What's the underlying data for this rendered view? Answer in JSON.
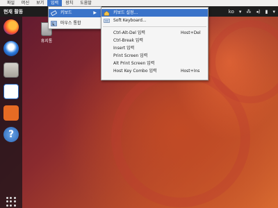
{
  "vm_menubar": {
    "items": [
      "파일",
      "머신",
      "보기",
      "입력",
      "장치",
      "도움말"
    ],
    "active_index": 3
  },
  "top_panel": {
    "activities": "현재 활동",
    "language": "ko"
  },
  "desktop": {
    "trash_label": "휴지통"
  },
  "input_menu": {
    "items": [
      {
        "label": "키보드",
        "icon": "keyboard-icon",
        "has_submenu": true
      },
      {
        "label": "마우스 통합",
        "icon": "mouse-integration-icon"
      }
    ]
  },
  "keyboard_submenu": {
    "items": [
      {
        "label": "키보드 설정...",
        "icon": "keyboard-settings-icon",
        "shortcut": ""
      },
      {
        "label": "Soft Keyboard...",
        "icon": "soft-keyboard-icon",
        "shortcut": ""
      }
    ],
    "key_items": [
      {
        "label": "Ctrl-Alt-Del 입력",
        "shortcut": "Host+Del"
      },
      {
        "label": "Ctrl-Break 입력",
        "shortcut": ""
      },
      {
        "label": "Insert 입력",
        "shortcut": ""
      },
      {
        "label": "Print Screen 입력",
        "shortcut": ""
      },
      {
        "label": "Alt Print Screen 입력",
        "shortcut": ""
      },
      {
        "label": "Host Key Combo 입력",
        "shortcut": "Host+Ins"
      }
    ]
  },
  "colors": {
    "highlight": "#3a73c9",
    "panel": "#1d1d1d",
    "menu_bg": "#f5f5f5"
  }
}
